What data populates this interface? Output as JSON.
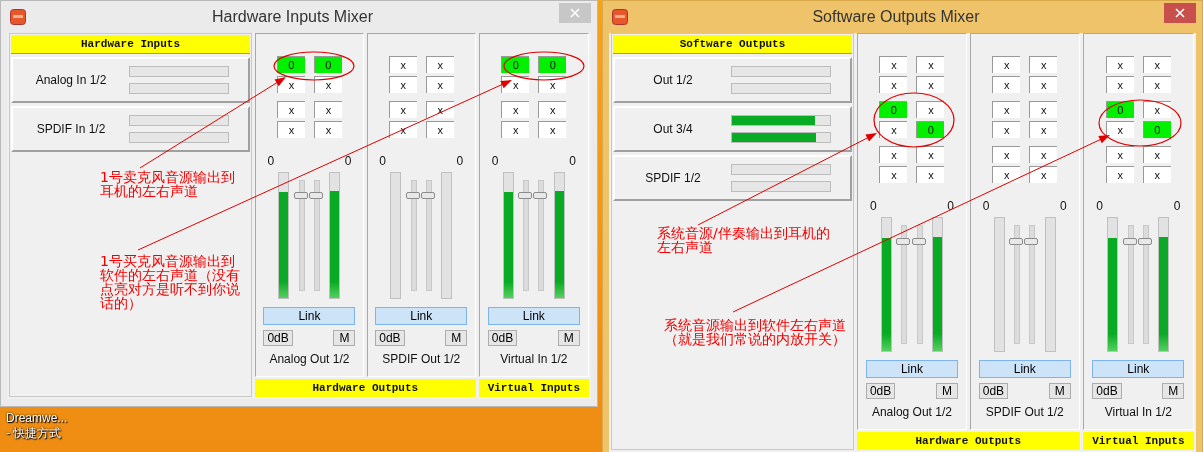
{
  "desktop": {
    "shortcut_label": "Dreamwe...\n- 快捷方式"
  },
  "windows": [
    {
      "title": "Hardware Inputs Mixer",
      "active": false,
      "sources": {
        "header": "Hardware Inputs",
        "rows": [
          {
            "name": "Analog In 1/2",
            "meters": [
              {
                "level": 0
              },
              {
                "level": 0
              }
            ]
          },
          {
            "name": "SPDIF In 1/2",
            "meters": [
              {
                "level": 0
              },
              {
                "level": 0
              }
            ]
          }
        ]
      },
      "groups": [
        {
          "label": "Hardware Outputs",
          "strips": [
            {
              "name": "Analog Out 1/2",
              "cells": [
                [
                  {
                    "value": "0",
                    "on": true
                  },
                  {
                    "value": "0",
                    "on": true
                  }
                ],
                [
                  {
                    "value": "x",
                    "on": false
                  },
                  {
                    "value": "x",
                    "on": false
                  }
                ],
                [
                  {
                    "value": "x",
                    "on": false
                  },
                  {
                    "value": "x",
                    "on": false
                  }
                ],
                [
                  {
                    "value": "x",
                    "on": false
                  },
                  {
                    "value": "x",
                    "on": false
                  }
                ]
              ],
              "peak_labels": [
                "0",
                "0"
              ],
              "meters": [
                {
                  "level": 0.85
                },
                {
                  "level": 0.86
                }
              ],
              "faders": [
                {
                  "level": 0.9
                },
                {
                  "level": 0.9
                }
              ],
              "link": "Link",
              "zero_db": "0dB",
              "mute": "M"
            },
            {
              "name": "SPDIF Out 1/2",
              "cells": [
                [
                  {
                    "value": "x",
                    "on": false
                  },
                  {
                    "value": "x",
                    "on": false
                  }
                ],
                [
                  {
                    "value": "x",
                    "on": false
                  },
                  {
                    "value": "x",
                    "on": false
                  }
                ],
                [
                  {
                    "value": "x",
                    "on": false
                  },
                  {
                    "value": "x",
                    "on": false
                  }
                ],
                [
                  {
                    "value": "x",
                    "on": false
                  },
                  {
                    "value": "x",
                    "on": false
                  }
                ]
              ],
              "peak_labels": [
                "0",
                "0"
              ],
              "meters": [
                {
                  "level": 0
                },
                {
                  "level": 0
                }
              ],
              "faders": [
                {
                  "level": 0.9
                },
                {
                  "level": 0.9
                }
              ],
              "link": "Link",
              "zero_db": "0dB",
              "mute": "M"
            }
          ]
        },
        {
          "label": "Virtual Inputs",
          "strips": [
            {
              "name": "Virtual In 1/2",
              "cells": [
                [
                  {
                    "value": "0",
                    "on": true
                  },
                  {
                    "value": "0",
                    "on": true
                  }
                ],
                [
                  {
                    "value": "x",
                    "on": false
                  },
                  {
                    "value": "x",
                    "on": false
                  }
                ],
                [
                  {
                    "value": "x",
                    "on": false
                  },
                  {
                    "value": "x",
                    "on": false
                  }
                ],
                [
                  {
                    "value": "x",
                    "on": false
                  },
                  {
                    "value": "x",
                    "on": false
                  }
                ]
              ],
              "peak_labels": [
                "0",
                "0"
              ],
              "meters": [
                {
                  "level": 0.85
                },
                {
                  "level": 0.86
                }
              ],
              "faders": [
                {
                  "level": 0.9
                },
                {
                  "level": 0.9
                }
              ],
              "link": "Link",
              "zero_db": "0dB",
              "mute": "M"
            }
          ]
        }
      ]
    },
    {
      "title": "Software Outputs Mixer",
      "active": true,
      "sources": {
        "header": "Software Outputs",
        "rows": [
          {
            "name": "Out 1/2",
            "meters": [
              {
                "level": 0
              },
              {
                "level": 0
              }
            ]
          },
          {
            "name": "Out 3/4",
            "meters": [
              {
                "level": 0.85
              },
              {
                "level": 0.86
              }
            ]
          },
          {
            "name": "SPDIF 1/2",
            "meters": [
              {
                "level": 0
              },
              {
                "level": 0
              }
            ]
          }
        ]
      },
      "groups": [
        {
          "label": "Hardware Outputs",
          "strips": [
            {
              "name": "Analog Out 1/2",
              "cells": [
                [
                  {
                    "value": "x",
                    "on": false
                  },
                  {
                    "value": "x",
                    "on": false
                  }
                ],
                [
                  {
                    "value": "x",
                    "on": false
                  },
                  {
                    "value": "x",
                    "on": false
                  }
                ],
                [
                  {
                    "value": "0",
                    "on": true
                  },
                  {
                    "value": "x",
                    "on": false
                  }
                ],
                [
                  {
                    "value": "x",
                    "on": false
                  },
                  {
                    "value": "0",
                    "on": true
                  }
                ],
                [
                  {
                    "value": "x",
                    "on": false
                  },
                  {
                    "value": "x",
                    "on": false
                  }
                ],
                [
                  {
                    "value": "x",
                    "on": false
                  },
                  {
                    "value": "x",
                    "on": false
                  }
                ]
              ],
              "peak_labels": [
                "0",
                "0"
              ],
              "meters": [
                {
                  "level": 0.85
                },
                {
                  "level": 0.86
                }
              ],
              "faders": [
                {
                  "level": 0.9
                },
                {
                  "level": 0.9
                }
              ],
              "link": "Link",
              "zero_db": "0dB",
              "mute": "M"
            },
            {
              "name": "SPDIF Out 1/2",
              "cells": [
                [
                  {
                    "value": "x",
                    "on": false
                  },
                  {
                    "value": "x",
                    "on": false
                  }
                ],
                [
                  {
                    "value": "x",
                    "on": false
                  },
                  {
                    "value": "x",
                    "on": false
                  }
                ],
                [
                  {
                    "value": "x",
                    "on": false
                  },
                  {
                    "value": "x",
                    "on": false
                  }
                ],
                [
                  {
                    "value": "x",
                    "on": false
                  },
                  {
                    "value": "x",
                    "on": false
                  }
                ],
                [
                  {
                    "value": "x",
                    "on": false
                  },
                  {
                    "value": "x",
                    "on": false
                  }
                ],
                [
                  {
                    "value": "x",
                    "on": false
                  },
                  {
                    "value": "x",
                    "on": false
                  }
                ]
              ],
              "peak_labels": [
                "0",
                "0"
              ],
              "meters": [
                {
                  "level": 0
                },
                {
                  "level": 0
                }
              ],
              "faders": [
                {
                  "level": 0.9
                },
                {
                  "level": 0.9
                }
              ],
              "link": "Link",
              "zero_db": "0dB",
              "mute": "M"
            }
          ]
        },
        {
          "label": "Virtual Inputs",
          "strips": [
            {
              "name": "Virtual In 1/2",
              "cells": [
                [
                  {
                    "value": "x",
                    "on": false
                  },
                  {
                    "value": "x",
                    "on": false
                  }
                ],
                [
                  {
                    "value": "x",
                    "on": false
                  },
                  {
                    "value": "x",
                    "on": false
                  }
                ],
                [
                  {
                    "value": "0",
                    "on": true
                  },
                  {
                    "value": "x",
                    "on": false
                  }
                ],
                [
                  {
                    "value": "x",
                    "on": false
                  },
                  {
                    "value": "0",
                    "on": true
                  }
                ],
                [
                  {
                    "value": "x",
                    "on": false
                  },
                  {
                    "value": "x",
                    "on": false
                  }
                ],
                [
                  {
                    "value": "x",
                    "on": false
                  },
                  {
                    "value": "x",
                    "on": false
                  }
                ]
              ],
              "peak_labels": [
                "0",
                "0"
              ],
              "meters": [
                {
                  "level": 0.85
                },
                {
                  "level": 0.86
                }
              ],
              "faders": [
                {
                  "level": 0.9
                },
                {
                  "level": 0.9
                }
              ],
              "link": "Link",
              "zero_db": "0dB",
              "mute": "M"
            }
          ]
        }
      ]
    }
  ],
  "annotations": [
    {
      "text": "1号卖克风音源输出到耳机的左右声道"
    },
    {
      "text": "1号买克风音源输出到软件的左右声道（没有点亮对方是听不到你说话的）"
    },
    {
      "text": "系统音源/伴奏输出到耳机的左右声道"
    },
    {
      "text": "系统音源输出到软件左右声道（就是我们常说的内放开关）"
    }
  ]
}
